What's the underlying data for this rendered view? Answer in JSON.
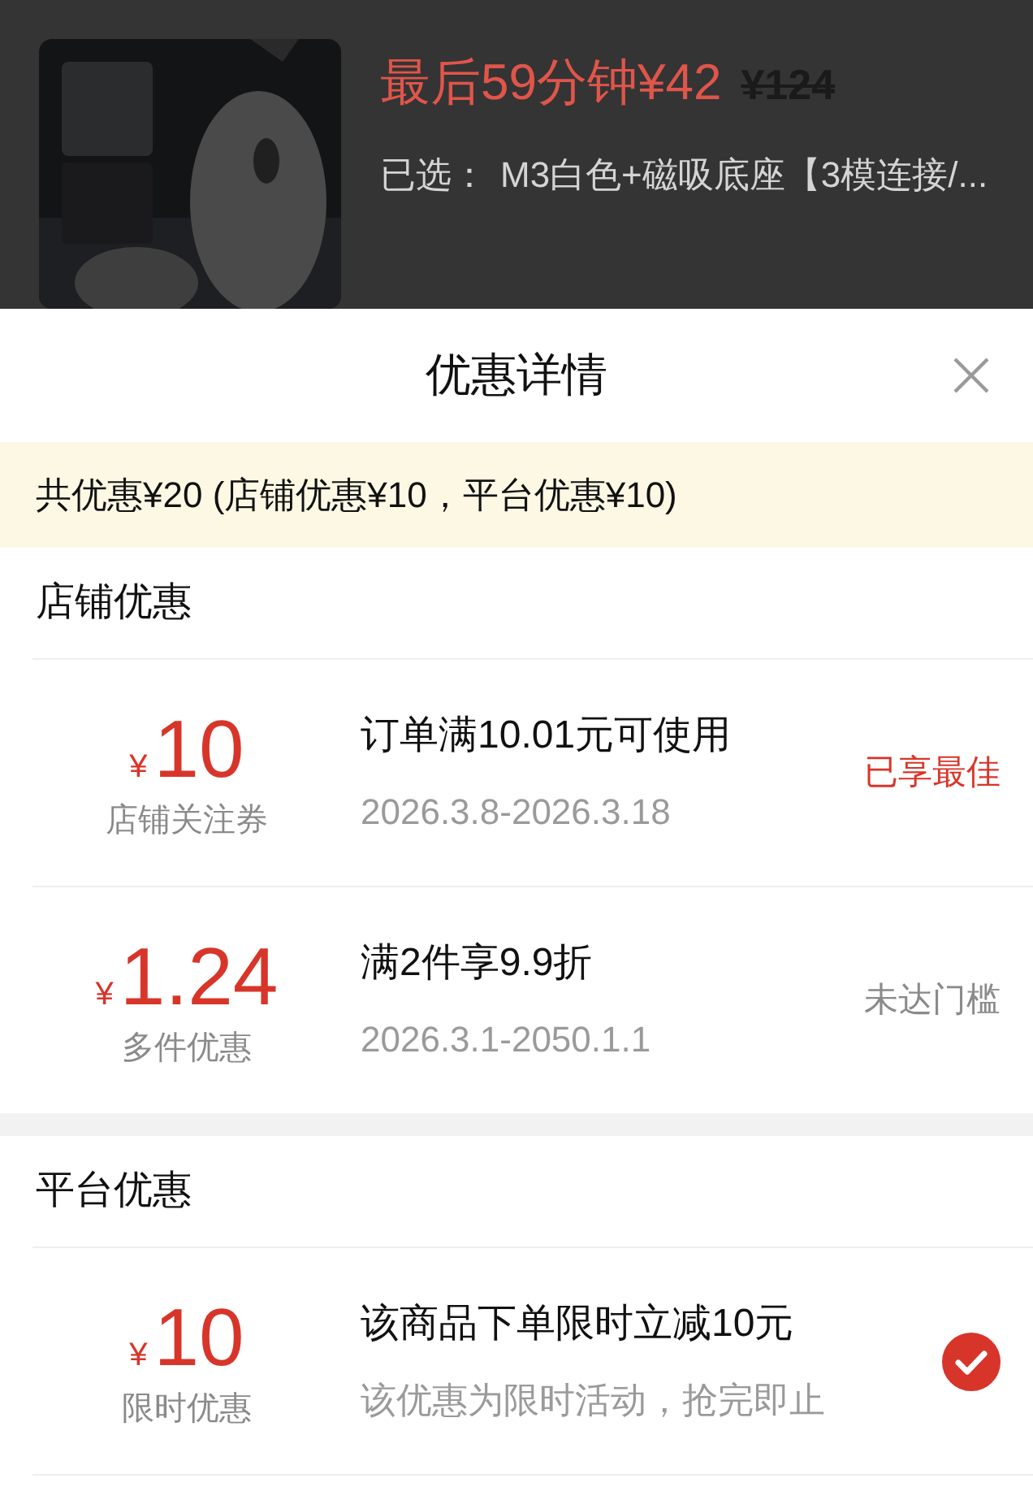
{
  "product": {
    "price_label": "最后59分钟¥42",
    "original_price": "¥124",
    "selected_label": "已选：",
    "selected_value": "M3白色+磁吸底座【3模连接/..."
  },
  "sheet": {
    "title": "优惠详情",
    "summary": "共优惠¥20 (店铺优惠¥10，平台优惠¥10)",
    "sections": [
      {
        "title": "店铺优惠",
        "coupons": [
          {
            "currency": "¥",
            "amount": "10",
            "name": "店铺关注券",
            "condition": "订单满10.01元可使用",
            "validity": "2026.3.8-2026.3.18",
            "status": {
              "kind": "best",
              "text": "已享最佳"
            }
          },
          {
            "currency": "¥",
            "amount": "1.24",
            "name": "多件优惠",
            "condition": "满2件享9.9折",
            "validity": "2026.3.1-2050.1.1",
            "status": {
              "kind": "unmet",
              "text": "未达门槛"
            }
          }
        ]
      },
      {
        "title": "平台优惠",
        "coupons": [
          {
            "currency": "¥",
            "amount": "10",
            "name": "限时优惠",
            "condition": "该商品下单限时立减10元",
            "validity": "该优惠为限时活动，抢完即止",
            "status": {
              "kind": "check",
              "selected": true
            }
          }
        ]
      }
    ]
  }
}
